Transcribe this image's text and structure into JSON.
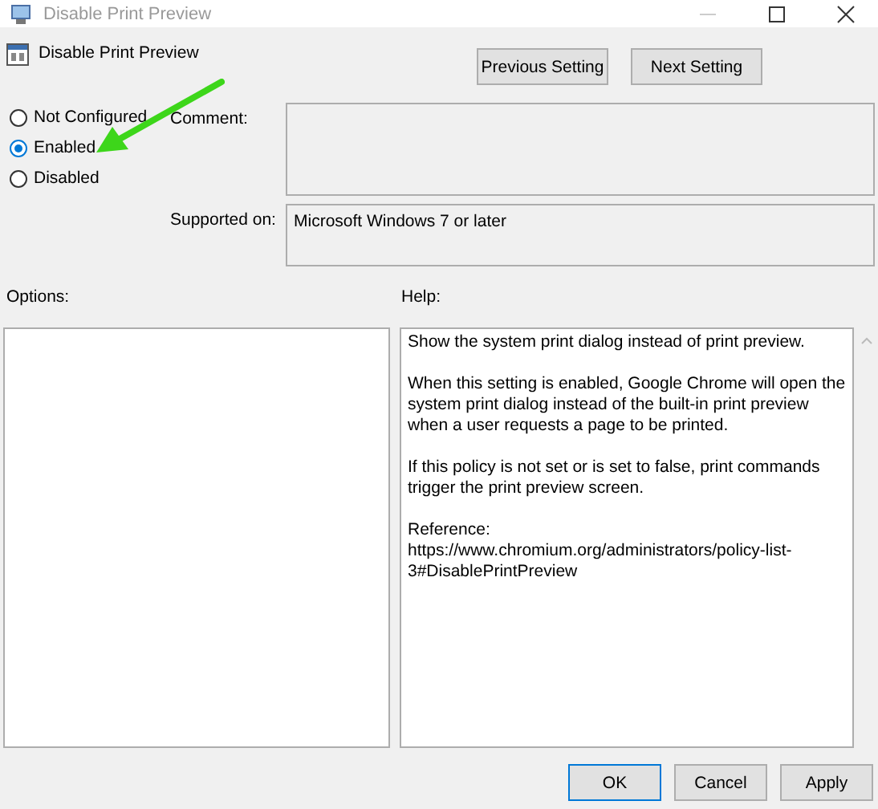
{
  "window": {
    "title": "Disable Print Preview"
  },
  "header": {
    "title": "Disable Print Preview"
  },
  "nav_buttons": [
    "Previous Setting",
    "Next Setting"
  ],
  "options": [
    {
      "label": "Not Configured",
      "selected": false
    },
    {
      "label": "Enabled",
      "selected": true
    },
    {
      "label": "Disabled",
      "selected": false
    }
  ],
  "comment": {
    "label": "Comment:"
  },
  "supported_on": {
    "label": "Supported on:",
    "value": "Microsoft Windows 7 or later"
  },
  "options_panel": {
    "label": "Options:"
  },
  "help": {
    "label": "Help:",
    "paragraphs": [
      "Show the system print dialog instead of print preview.",
      "When this setting is enabled, Google Chrome will open the system print dialog instead of the built-in print preview when a user requests a page to be printed.",
      "If this policy is not set or is set to false, print commands trigger the print preview screen.",
      "Reference: https://www.chromium.org/administrators/policy-list-3#DisablePrintPreview"
    ]
  },
  "buttons": [
    {
      "label": "OK",
      "kind": "default"
    },
    {
      "label": "Cancel",
      "kind": "normal"
    },
    {
      "label": "Apply",
      "kind": "normal"
    }
  ]
}
